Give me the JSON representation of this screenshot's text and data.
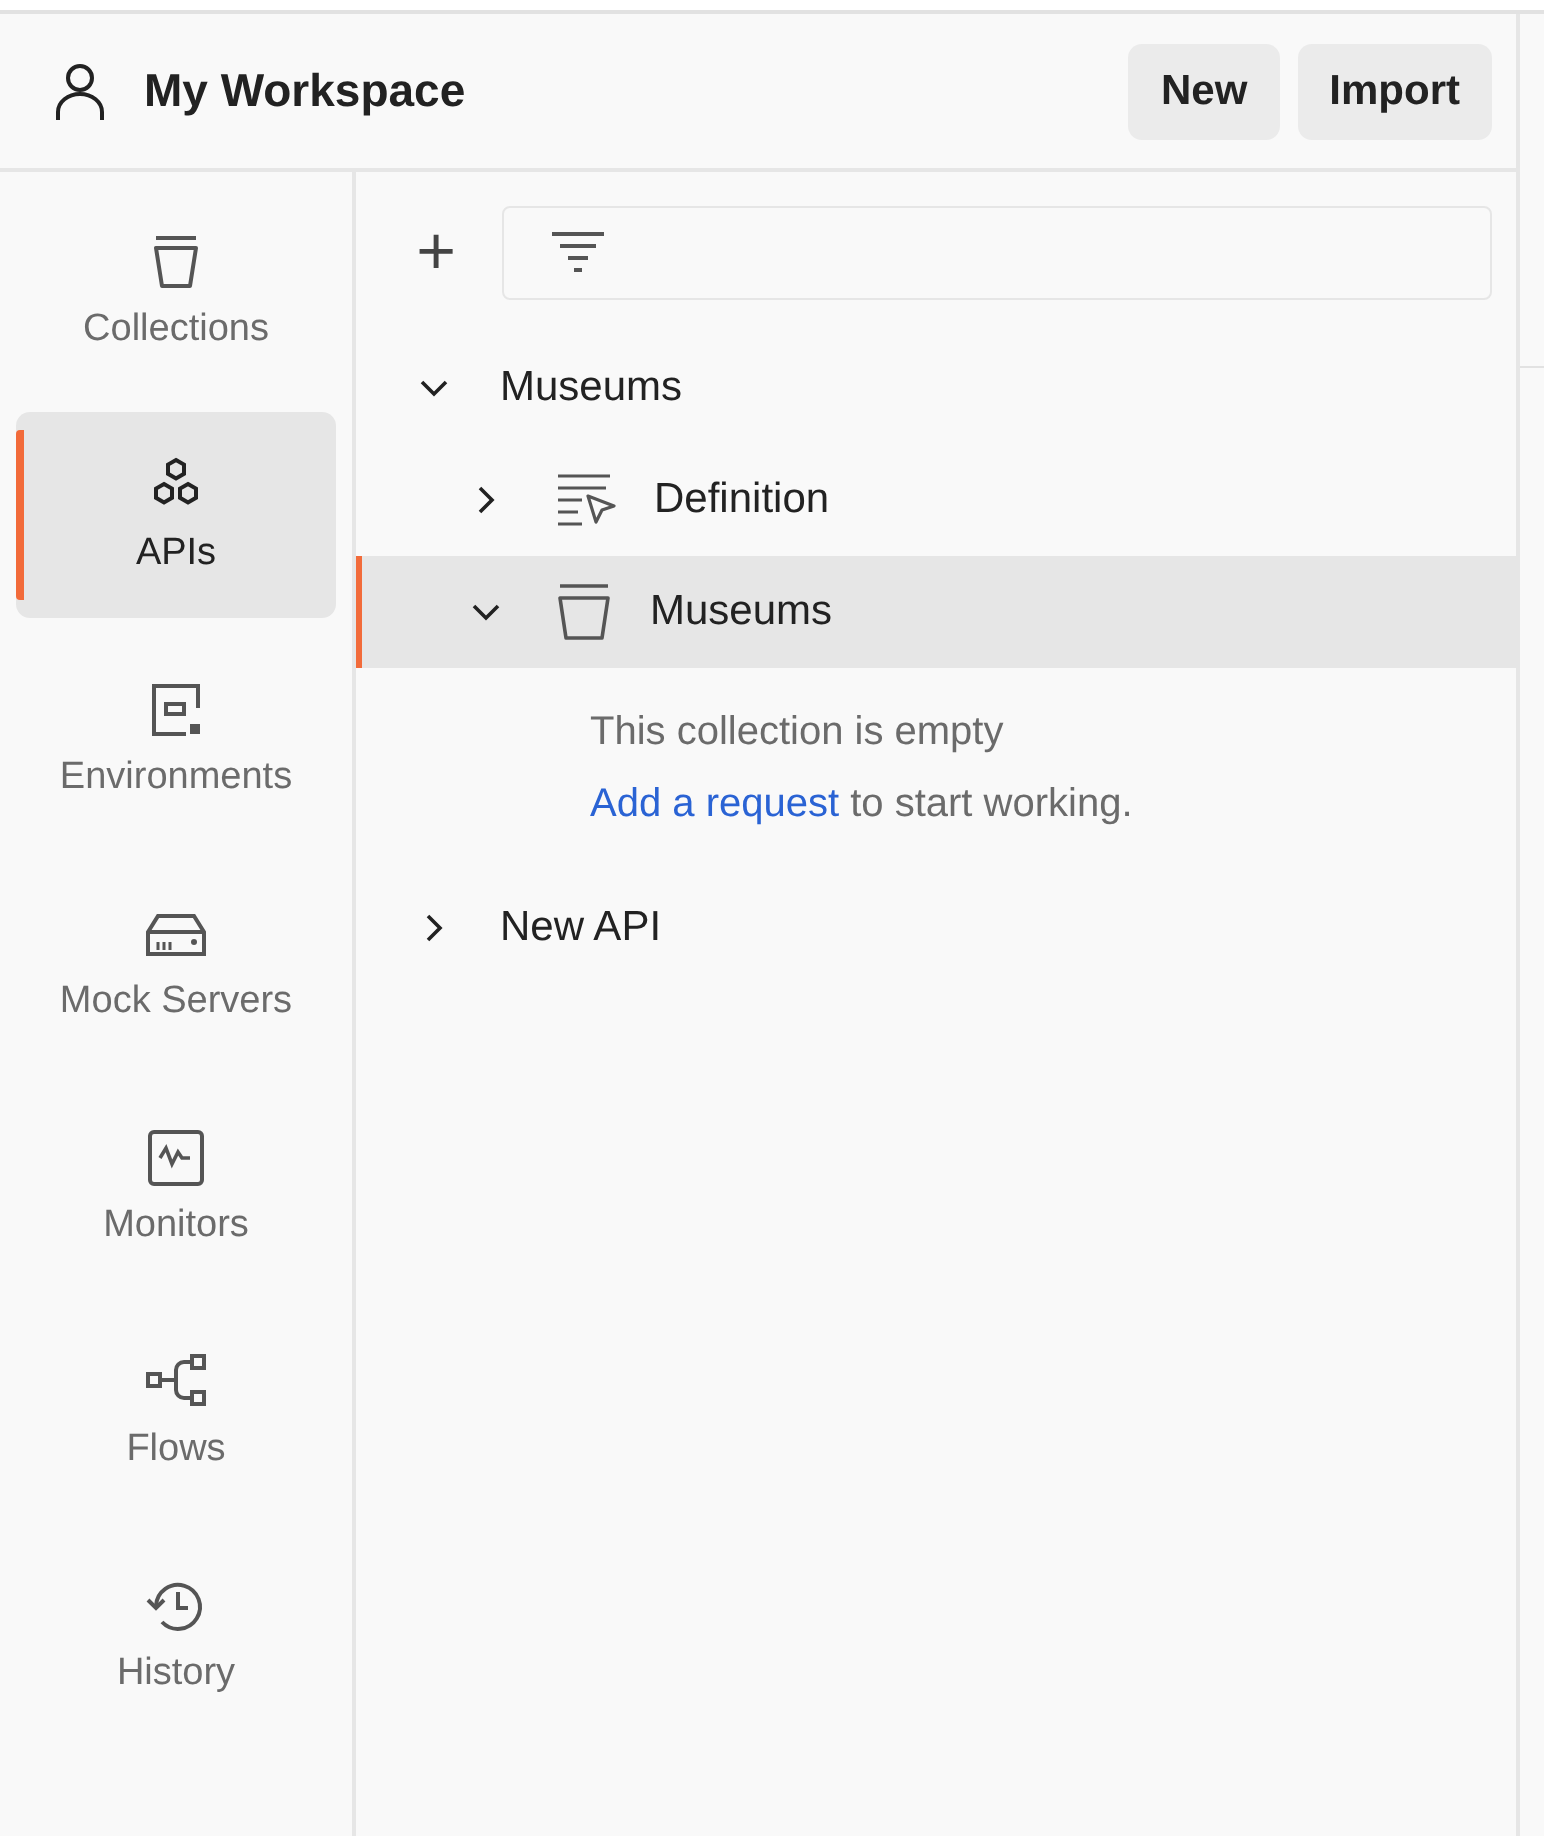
{
  "header": {
    "title": "My Workspace",
    "buttons": [
      "New",
      "Import"
    ]
  },
  "sidebar": {
    "items": [
      {
        "label": "Collections",
        "kind": "collections",
        "selected": false
      },
      {
        "label": "APIs",
        "kind": "apis",
        "selected": true
      },
      {
        "label": "Environments",
        "kind": "environments",
        "selected": false
      },
      {
        "label": "Mock Servers",
        "kind": "mock",
        "selected": false
      },
      {
        "label": "Monitors",
        "kind": "monitors",
        "selected": false
      },
      {
        "label": "Flows",
        "kind": "flows",
        "selected": false
      },
      {
        "label": "History",
        "kind": "history",
        "selected": false
      }
    ]
  },
  "toolbar": {
    "add_symbol": "+"
  },
  "tree": [
    {
      "label": "Museums",
      "expanded": true,
      "selected": false,
      "children": [
        {
          "label": "Definition",
          "kind": "definition",
          "expanded": false,
          "selected": false
        },
        {
          "label": "Museums",
          "kind": "collection",
          "expanded": true,
          "selected": true,
          "empty_message": "This collection is empty",
          "link": "Add a request",
          "after_link": "to start working."
        }
      ]
    },
    {
      "label": "New API",
      "expanded": false,
      "selected": false
    }
  ]
}
